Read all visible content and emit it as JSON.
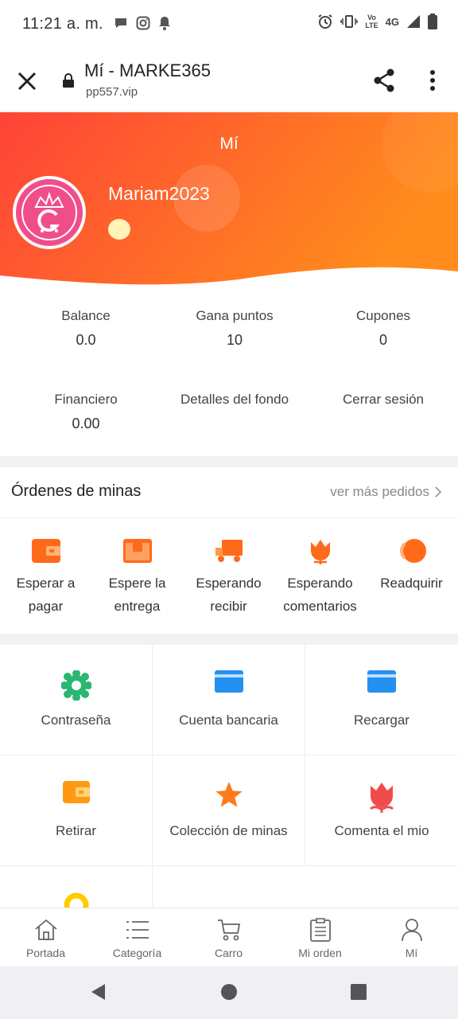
{
  "status_bar": {
    "time": "11:21 a. m.",
    "network": "4G",
    "volte": [
      "Vo",
      "LTE"
    ]
  },
  "browser": {
    "title": "Mí - MARKE365",
    "url": "pp557.vip"
  },
  "hero": {
    "title": "Mí",
    "username": "Mariam2023"
  },
  "stats": [
    {
      "label": "Balance",
      "value": "0.0"
    },
    {
      "label": "Gana puntos",
      "value": "10"
    },
    {
      "label": "Cupones",
      "value": "0"
    },
    {
      "label": "Financiero",
      "value": "0.00"
    },
    {
      "label": "Detalles del fondo",
      "value": ""
    },
    {
      "label": "Cerrar sesión",
      "value": ""
    }
  ],
  "orders": {
    "title": "Órdenes de minas",
    "more": "ver más pedidos",
    "items": [
      {
        "label": "Esperar a pagar",
        "icon": "wallet-icon"
      },
      {
        "label": "Espere la entrega",
        "icon": "box-icon"
      },
      {
        "label": "Esperando recibir",
        "icon": "truck-icon"
      },
      {
        "label": "Esperando comentarios",
        "icon": "flower-icon"
      },
      {
        "label": "Readquirir",
        "icon": "refund-icon"
      }
    ]
  },
  "grid": [
    {
      "label": "Contraseña",
      "icon": "gear-icon"
    },
    {
      "label": "Cuenta bancaria",
      "icon": "card-icon"
    },
    {
      "label": "Recargar",
      "icon": "card-icon"
    },
    {
      "label": "Retirar",
      "icon": "wallet-icon"
    },
    {
      "label": "Colección de minas",
      "icon": "star-icon"
    },
    {
      "label": "Comenta el mio",
      "icon": "flower-icon"
    },
    {
      "label": "",
      "icon": "ring-icon"
    }
  ],
  "tabs": [
    {
      "label": "Portada",
      "icon": "home-icon"
    },
    {
      "label": "Categoría",
      "icon": "list-icon"
    },
    {
      "label": "Carro",
      "icon": "cart-icon"
    },
    {
      "label": "Mi orden",
      "icon": "clipboard-icon"
    },
    {
      "label": "Mí",
      "icon": "user-icon"
    }
  ],
  "colors": {
    "hero_gradient_start": "#ff4a3a",
    "hero_gradient_end": "#ff8a1e",
    "icon_orange": "#ff7a1a",
    "icon_blue": "#2490f0",
    "icon_green": "#2bb673",
    "icon_red": "#f04c4c",
    "icon_yellow": "#ffcc00"
  }
}
